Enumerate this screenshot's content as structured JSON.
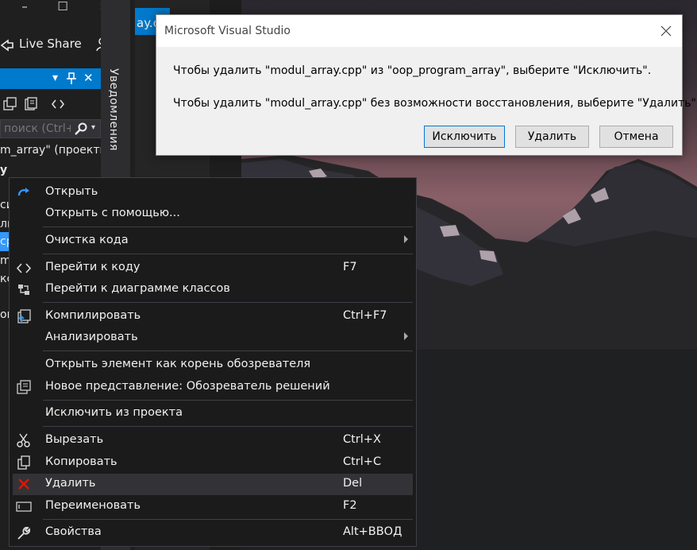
{
  "window": {
    "minimize_glyph": "–",
    "maximize_glyph": "☐",
    "close_glyph": "✕"
  },
  "toolbar": {
    "live_share_label": "Live Share"
  },
  "solution_explorer": {
    "pin_glyph": "▾ 🖈 ✕",
    "search_placeholder": "поиск (Ctrl+",
    "tree_lines": [
      {
        "text": "m_array\" (проекты"
      },
      {
        "text": "y"
      },
      {
        "text": "си"
      },
      {
        "text": "ль"
      },
      {
        "text": "ср"
      },
      {
        "text": "m_"
      },
      {
        "text": "кс"
      },
      {
        "text": "ов"
      }
    ]
  },
  "notifications_tab": {
    "label": "Уведомления"
  },
  "editor": {
    "tab_fragment": "ay.cp"
  },
  "context_menu": {
    "items": [
      {
        "label": "Открыть",
        "key": "",
        "icon": "refresh-arrow-icon"
      },
      {
        "label": "Открыть с помощью...",
        "key": "",
        "icon": ""
      },
      {
        "label": "Очистка кода",
        "key": "",
        "icon": "",
        "submenu": true
      },
      {
        "label": "Перейти к коду",
        "key": "F7",
        "icon": "code-brackets-icon"
      },
      {
        "label": "Перейти к диаграмме классов",
        "key": "",
        "icon": "class-diagram-icon"
      },
      {
        "label": "Компилировать",
        "key": "Ctrl+F7",
        "icon": "compile-icon"
      },
      {
        "label": "Анализировать",
        "key": "",
        "icon": "",
        "submenu": true
      },
      {
        "label": "Открыть элемент как корень обозревателя",
        "key": "",
        "icon": ""
      },
      {
        "label": "Новое представление: Обозреватель решений",
        "key": "",
        "icon": "new-view-icon"
      },
      {
        "label": "Исключить из проекта",
        "key": "",
        "icon": ""
      },
      {
        "label": "Вырезать",
        "key": "Ctrl+X",
        "icon": "scissors-icon"
      },
      {
        "label": "Копировать",
        "key": "Ctrl+C",
        "icon": "copy-icon"
      },
      {
        "label": "Удалить",
        "key": "Del",
        "icon": "delete-x-icon"
      },
      {
        "label": "Переименовать",
        "key": "F2",
        "icon": "rename-icon"
      },
      {
        "label": "Свойства",
        "key": "Alt+ВВОД",
        "icon": "wrench-icon"
      }
    ]
  },
  "dialog": {
    "title": "Microsoft Visual Studio",
    "message_1": "Чтобы удалить \"modul_array.cpp\" из \"oop_program_array\", выберите \"Исключить\".",
    "message_2": "Чтобы удалить \"modul_array.cpp\" без возможности восстановления, выберите \"Удалить\".",
    "buttons": {
      "exclude": "Исключить",
      "delete": "Удалить",
      "cancel": "Отмена"
    }
  },
  "colors": {
    "accent": "#007acc",
    "delete_icon": "#e51400",
    "menu_bg": "#1b1b1c",
    "dialog_bg": "#f0f0f0"
  }
}
